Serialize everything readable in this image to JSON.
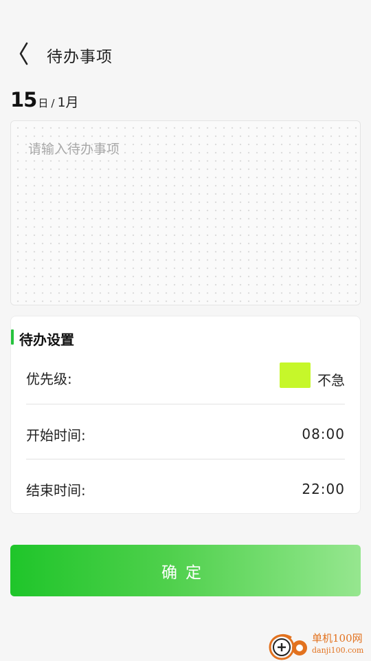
{
  "header": {
    "title": "待办事项",
    "back_icon": "chevron-left-icon"
  },
  "date": {
    "day": "15",
    "day_unit": "日",
    "separator": "/",
    "month": "1月"
  },
  "note": {
    "placeholder": "请输入待办事项",
    "value": ""
  },
  "settings": {
    "title": "待办设置",
    "accent_color": "#27c33e",
    "priority": {
      "label": "优先级:",
      "value": "不急",
      "color": "#c6f72a"
    },
    "start_time": {
      "label": "开始时间:",
      "value": "08:00"
    },
    "end_time": {
      "label": "结束时间:",
      "value": "22:00"
    }
  },
  "confirm_button": {
    "label": "确定",
    "gradient_start": "#1fc52a",
    "gradient_end": "#96e68f"
  },
  "watermark": {
    "name": "单机100网",
    "url": "danji100.com"
  }
}
